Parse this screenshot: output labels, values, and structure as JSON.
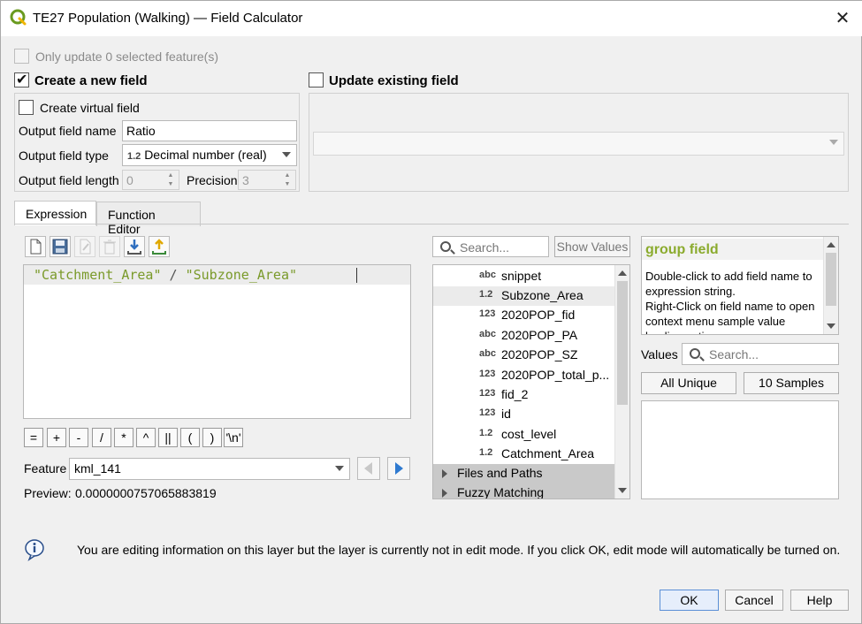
{
  "window": {
    "title": "TE27 Population (Walking) — Field Calculator",
    "close_icon": "close-icon"
  },
  "selection": {
    "only_update_label": "Only update 0 selected feature(s)",
    "only_update_checked": false
  },
  "create_field": {
    "label": "Create a new field",
    "checked": true,
    "virtual_label": "Create virtual field",
    "output_name_label": "Output field name",
    "output_name_value": "Ratio",
    "output_type_label": "Output field type",
    "output_type_icon": "1.2",
    "output_type_value": "Decimal number (real)",
    "output_length_label": "Output field length",
    "output_length_value": "0",
    "precision_label": "Precision",
    "precision_value": "3"
  },
  "update_field": {
    "label": "Update existing field",
    "checked": false,
    "selected_value": ""
  },
  "tabs": [
    {
      "label": "Expression",
      "active": true
    },
    {
      "label": "Function Editor",
      "active": false
    }
  ],
  "expression": {
    "text_a": "\"Catchment_Area\"",
    "operator": " / ",
    "text_b": "\"Subzone_Area\"",
    "toolbar_icons": [
      "new-file-icon",
      "save-icon",
      "edit-icon",
      "delete-icon",
      "import-icon",
      "export-icon"
    ]
  },
  "operators": [
    "=",
    "+",
    "-",
    "/",
    "*",
    "^",
    "||",
    "(",
    ")",
    "'\\n'"
  ],
  "feature": {
    "label": "Feature",
    "value": "kml_141"
  },
  "preview": {
    "label": "Preview:",
    "value": "0.0000000757065883819"
  },
  "function_list": {
    "search_placeholder": "Search...",
    "show_values_label": "Show Values",
    "items": [
      {
        "type": "abc",
        "name": "snippet"
      },
      {
        "type": "1.2",
        "name": "Subzone_Area",
        "selected": true
      },
      {
        "type": "123",
        "name": "2020POP_fid"
      },
      {
        "type": "abc",
        "name": "2020POP_PA"
      },
      {
        "type": "abc",
        "name": "2020POP_SZ"
      },
      {
        "type": "123",
        "name": "2020POP_total_p..."
      },
      {
        "type": "123",
        "name": "fid_2"
      },
      {
        "type": "123",
        "name": "id"
      },
      {
        "type": "1.2",
        "name": "cost_level"
      },
      {
        "type": "1.2",
        "name": "Catchment_Area"
      }
    ],
    "groups": [
      "Files and Paths",
      "Fuzzy Matching"
    ]
  },
  "help": {
    "title": "group field",
    "line1": "Double-click to add field name to expression string.",
    "line2": "Right-Click on field name to open context menu sample value loading options."
  },
  "values": {
    "label": "Values",
    "search_placeholder": "Search...",
    "all_unique_label": "All Unique",
    "samples_label": "10 Samples"
  },
  "info": {
    "message": "You are editing information on this layer but the layer is currently not in edit mode. If you click OK, edit mode will automatically be turned on."
  },
  "buttons": {
    "ok": "OK",
    "cancel": "Cancel",
    "help": "Help"
  }
}
